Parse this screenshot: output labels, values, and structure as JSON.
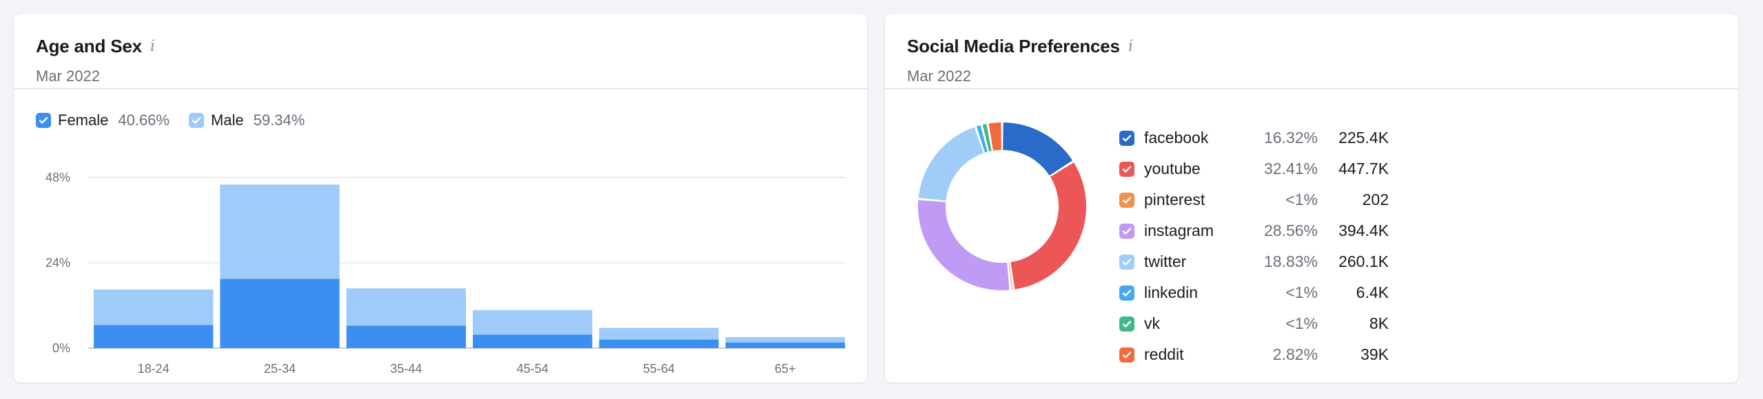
{
  "age_card": {
    "title": "Age and Sex",
    "date": "Mar 2022",
    "legend": [
      {
        "label": "Female",
        "pct": "40.66%",
        "color": "#3a8ff0"
      },
      {
        "label": "Male",
        "pct": "59.34%",
        "color": "#9ecbfa"
      }
    ]
  },
  "social_card": {
    "title": "Social Media Preferences",
    "date": "Mar 2022",
    "items": [
      {
        "name": "facebook",
        "pct": "16.32%",
        "count": "225.4K",
        "color": "#2a6ac8",
        "share": 16.32
      },
      {
        "name": "youtube",
        "pct": "32.41%",
        "count": "447.7K",
        "color": "#ec5656",
        "share": 32.41
      },
      {
        "name": "pinterest",
        "pct": "<1%",
        "count": "202",
        "color": "#f2914d",
        "share": 0.6
      },
      {
        "name": "instagram",
        "pct": "28.56%",
        "count": "394.4K",
        "color": "#bf9bf5",
        "share": 28.56
      },
      {
        "name": "twitter",
        "pct": "18.83%",
        "count": "260.1K",
        "color": "#9fcdf8",
        "share": 18.83
      },
      {
        "name": "linkedin",
        "pct": "<1%",
        "count": "6.4K",
        "color": "#45a8ee",
        "share": 1.2
      },
      {
        "name": "vk",
        "pct": "<1%",
        "count": "8K",
        "color": "#41b78c",
        "share": 1.2
      },
      {
        "name": "reddit",
        "pct": "2.82%",
        "count": "39K",
        "color": "#f26a3b",
        "share": 2.82
      }
    ]
  },
  "chart_data": {
    "type": "bar",
    "stacked": true,
    "categories": [
      "18-24",
      "25-34",
      "35-44",
      "45-54",
      "55-64",
      "65+"
    ],
    "series": [
      {
        "name": "Female",
        "values": [
          6.5,
          19.5,
          6.3,
          3.8,
          2.4,
          1.6
        ]
      },
      {
        "name": "Male",
        "values": [
          10.0,
          26.5,
          10.5,
          6.9,
          3.3,
          1.5
        ]
      }
    ],
    "yticks": [
      "0%",
      "24%",
      "48%"
    ],
    "ylim": [
      0,
      48
    ],
    "grid": true
  }
}
